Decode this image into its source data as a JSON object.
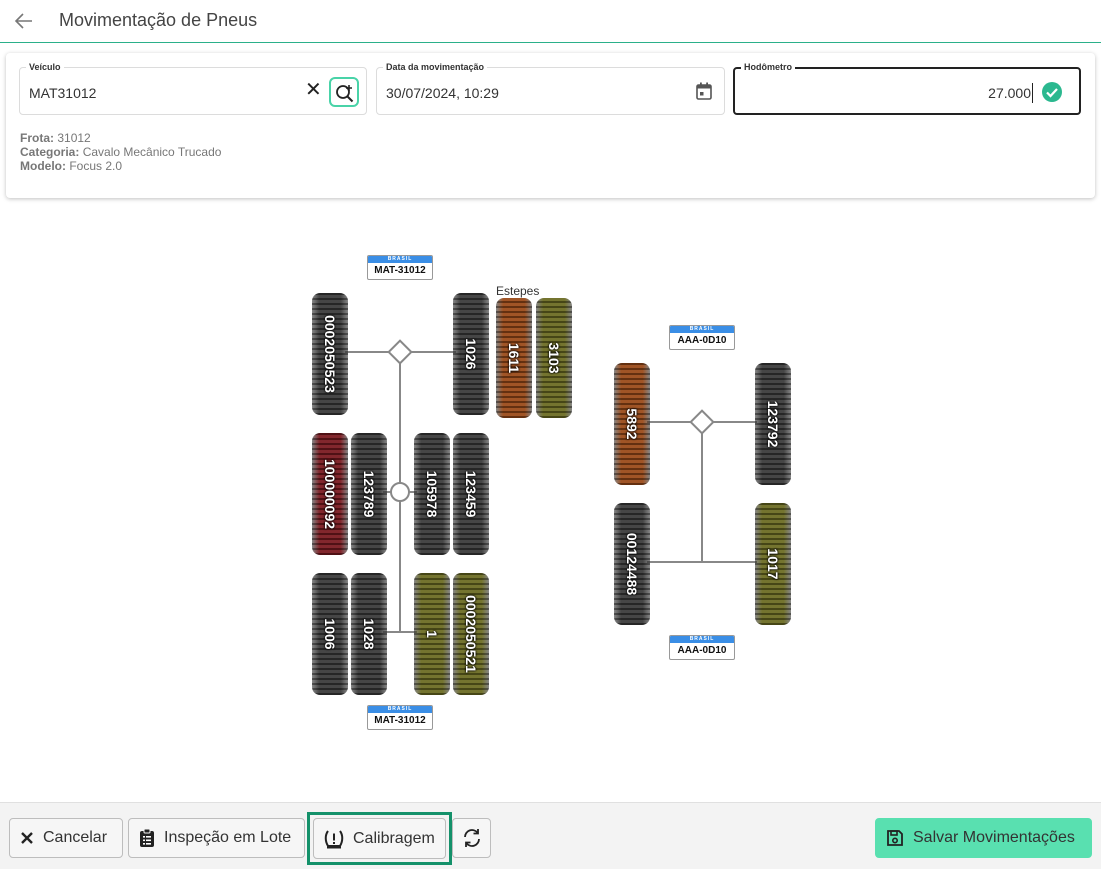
{
  "header": {
    "title": "Movimentação de Pneus"
  },
  "form": {
    "veiculo": {
      "label": "Veículo",
      "value": "MAT31012"
    },
    "data": {
      "label": "Data da movimentação",
      "value": "30/07/2024, 10:29"
    },
    "hodometro": {
      "label": "Hodômetro",
      "value": "27.000"
    }
  },
  "info": {
    "frota_label": "Frota:",
    "frota": "31012",
    "categoria_label": "Categoria:",
    "categoria": "Cavalo Mecânico Trucado",
    "modelo_label": "Modelo:",
    "modelo": "Focus 2.0"
  },
  "diagram": {
    "estepes_label": "Estepes",
    "plate_band": "BRASIL",
    "truck": {
      "plate_top": "MAT-31012",
      "plate_bottom": "MAT-31012",
      "tires": [
        "0002050523",
        "1026",
        "100000092",
        "123789",
        "105978",
        "123459",
        "1006",
        "1028",
        "1",
        "0002050521"
      ],
      "spares": [
        "1611",
        "3103"
      ]
    },
    "trailer": {
      "plate_top": "AAA-0D10",
      "plate_bottom": "AAA-0D10",
      "tires": [
        "5892",
        "123792",
        "00124488",
        "1017"
      ]
    }
  },
  "footer": {
    "cancel": "Cancelar",
    "lote": "Inspeção em Lote",
    "calibragem": "Calibragem",
    "save": "Salvar Movimentações"
  },
  "colors": {
    "accent": "#59e0b0",
    "accent_dark": "#14916a",
    "tire_black": "#3a3a3a",
    "tire_orange": "#9a4a18",
    "tire_olive": "#6b6b22",
    "tire_red": "#7a1a20"
  }
}
